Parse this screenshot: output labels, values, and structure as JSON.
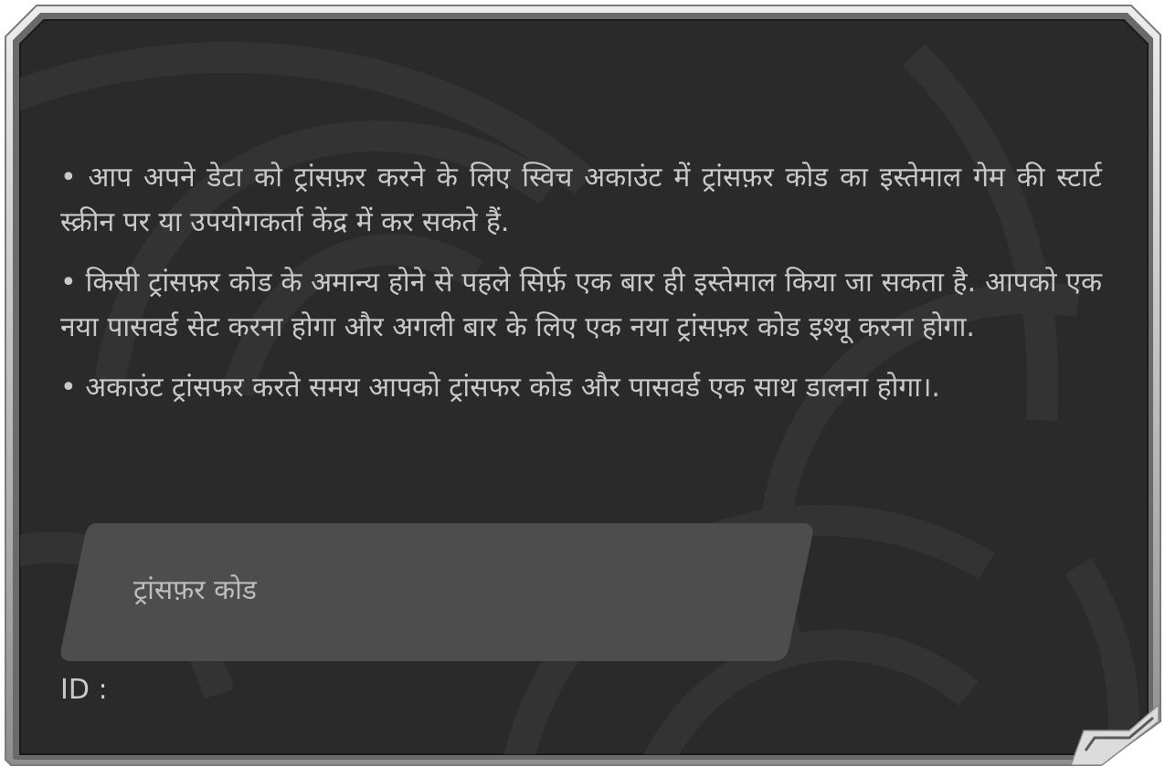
{
  "dialog": {
    "paragraphs": [
      "• आप अपने डेटा को ट्रांसफ़र करने के लिए स्विच अकाउंट में ट्रांसफ़र कोड का इस्तेमाल गेम की स्टार्ट स्क्रीन पर या उपयोगकर्ता केंद्र में कर सकते हैं.",
      "• किसी ट्रांसफ़र कोड के अमान्य होने से पहले सिर्फ़ एक बार ही इस्तेमाल किया जा सकता है. आपको एक नया पासवर्ड सेट करना होगा और अगली बार के लिए एक नया ट्रांसफ़र कोड इश्यू करना होगा.",
      "• अकाउंट ट्रांसफर करते समय आपको ट्रांसफर कोड और पासवर्ड एक साथ डालना होगा।."
    ],
    "transfer_code_field": {
      "placeholder": "ट्रांसफ़र कोड",
      "value": ""
    },
    "id_label": "ID :",
    "id_value": ""
  },
  "colors": {
    "panel_background": "#2a2a2a",
    "frame_outer": "#cfcfcf",
    "frame_inner": "#5a5a5a",
    "text": "#c9c9c9",
    "field_background": "#4d4d4d",
    "background_pattern": "#333333"
  },
  "icons": {
    "frame_corner": "corner-notch-icon"
  }
}
